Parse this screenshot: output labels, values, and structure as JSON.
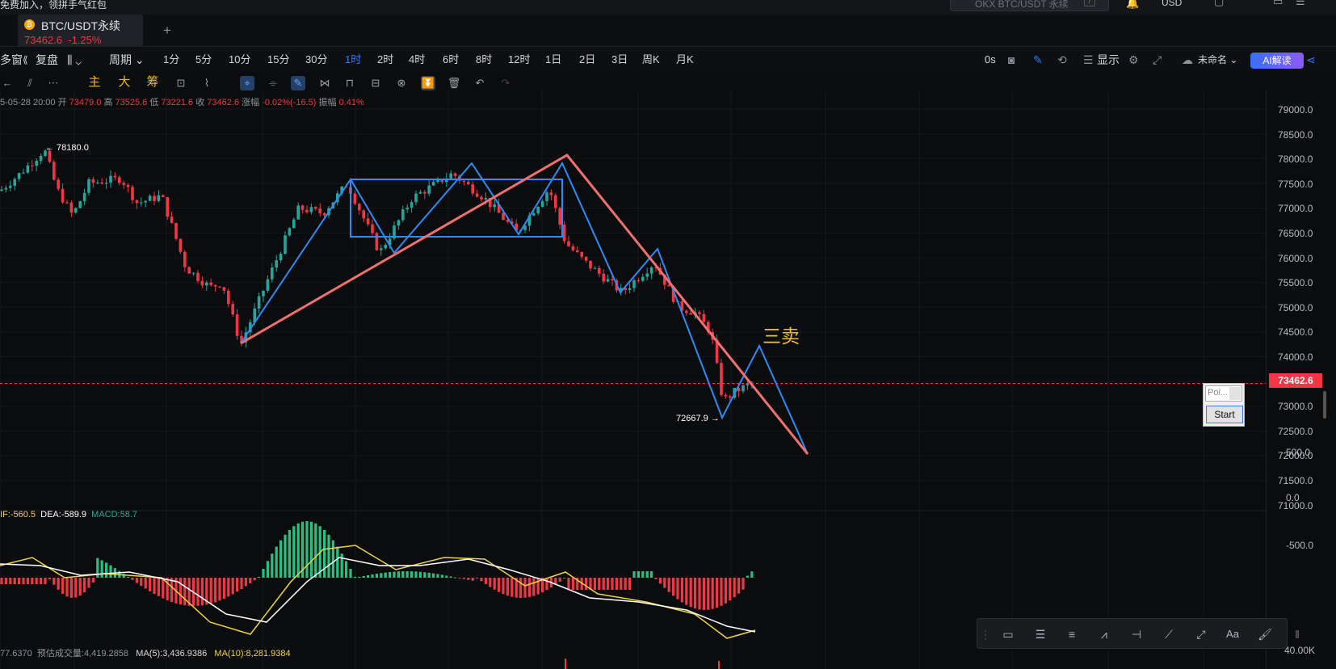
{
  "topbar": {
    "promo": "免费加入，领拼手气红包",
    "search_placeholder": "OKX BTC/USDT 永续",
    "search_key": "/",
    "currency": "USD"
  },
  "tab": {
    "name": "BTC/USDT永续",
    "price": "73462.6",
    "change": "-1.25%",
    "add": "+"
  },
  "toolbar1": {
    "multi": "多窗",
    "replay": "复盘",
    "period": "周期",
    "timeframes": [
      "1分",
      "5分",
      "10分",
      "15分",
      "30分",
      "1时",
      "2时",
      "4时",
      "6时",
      "8时",
      "12时",
      "1日",
      "2日",
      "3日",
      "周K",
      "月K"
    ],
    "active_timeframe": "1时",
    "countdown": "0s",
    "display": "显示",
    "unnamed": "未命名",
    "ai": "AI解读"
  },
  "indicators": {
    "main": "主",
    "big": "大",
    "chips": "筹"
  },
  "ohlc": {
    "date": "5-05-28 20:00",
    "open_l": "开",
    "open": "73479.0",
    "high_l": "高",
    "high": "73525.6",
    "low_l": "低",
    "low": "73221.6",
    "close_l": "收",
    "close": "73462.6",
    "chg_l": "涨幅",
    "chg": "-0.02%(-16.5)",
    "amp_l": "振幅",
    "amp": "0.41%"
  },
  "macd": {
    "dif": "IF:-560.5",
    "dea": "DEA:-589.9",
    "macd": "MACD:58.7"
  },
  "volume": {
    "vol": "77.6370",
    "est": "预估成交量:4,419.2858",
    "ma5": "MA(5):3,436.9386",
    "ma10": "MA(10):8,281.9384"
  },
  "price_axis": [
    "79000.0",
    "78500.0",
    "78000.0",
    "77500.0",
    "77000.0",
    "76500.0",
    "76000.0",
    "75500.0",
    "75000.0",
    "74500.0",
    "74000.0",
    "73500.0",
    "73000.0",
    "72500.0",
    "72000.0",
    "71500.0",
    "71000.0"
  ],
  "macd_axis": [
    "500.0",
    "0.0",
    "-500.0"
  ],
  "vol_axis": "40.00K",
  "current_price": "73462.6",
  "labels": {
    "high": "← 78180.0",
    "low": "72667.9 →",
    "annotation": "三卖"
  },
  "widget": {
    "input_placeholder": "Poi...",
    "start": "Start"
  },
  "colors": {
    "up": "#26a69a",
    "down": "#f23645",
    "accent": "#2f7bf0",
    "annotation": "#f0c419"
  }
}
